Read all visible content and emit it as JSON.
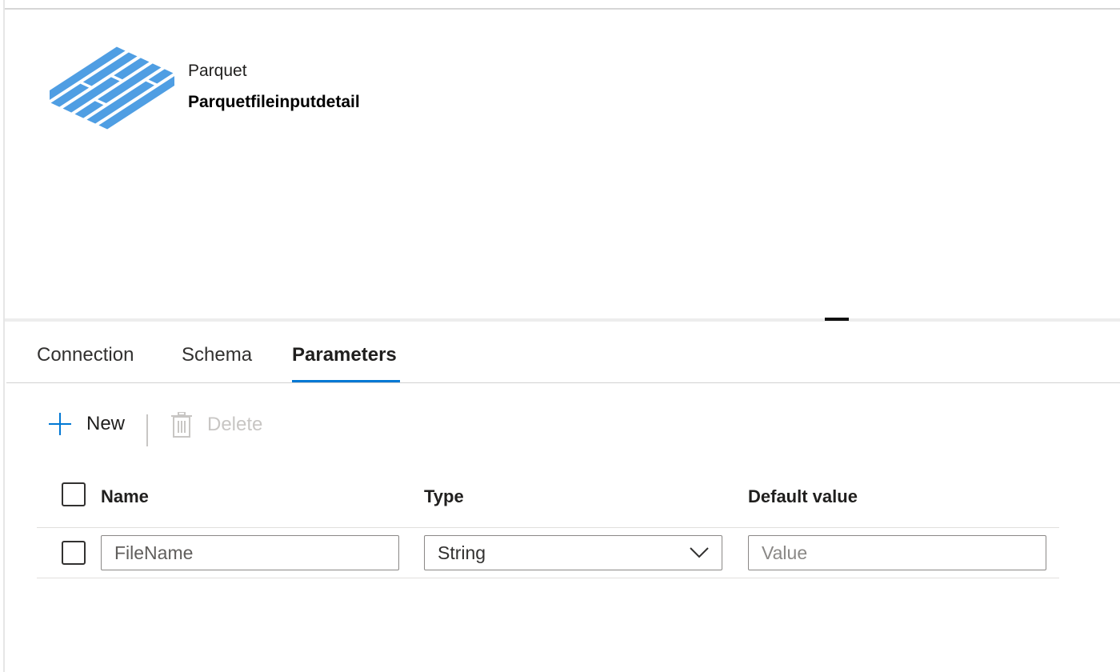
{
  "header": {
    "dataset_type": "Parquet",
    "dataset_name": "Parquetfileinputdetail",
    "icon": "parquet-icon",
    "icon_color": "#4f9ee3"
  },
  "tabs": [
    {
      "label": "Connection",
      "active": false
    },
    {
      "label": "Schema",
      "active": false
    },
    {
      "label": "Parameters",
      "active": true
    }
  ],
  "toolbar": {
    "new_label": "New",
    "new_icon": "plus-icon",
    "delete_label": "Delete",
    "delete_icon": "trash-icon",
    "delete_enabled": false
  },
  "grid": {
    "columns": [
      "Name",
      "Type",
      "Default value"
    ],
    "rows": [
      {
        "name_value": "FileName",
        "type_value": "String",
        "default_placeholder": "Value",
        "default_value": ""
      }
    ]
  },
  "colors": {
    "accent": "#0078d4",
    "disabled": "#c8c6c4"
  }
}
